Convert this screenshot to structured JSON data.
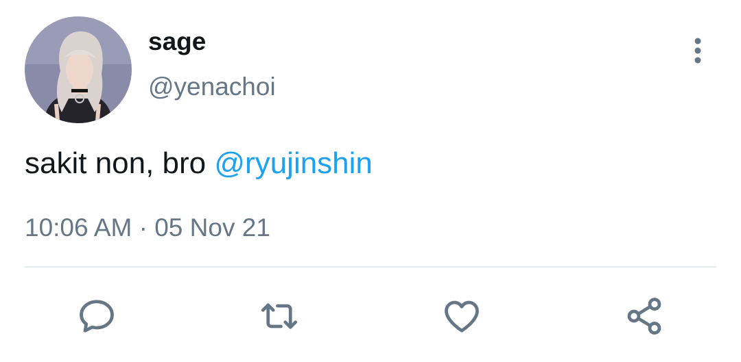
{
  "tweet": {
    "author": {
      "display_name": "sage",
      "handle": "@yenachoi",
      "avatar_icon": "profile-photo"
    },
    "text": "sakit non, bro ",
    "mention": "@ryujinshin",
    "time": "10:06 AM",
    "separator": "·",
    "date": "05 Nov 21"
  },
  "actions": [
    {
      "name": "reply",
      "icon": "reply-icon"
    },
    {
      "name": "retweet",
      "icon": "retweet-icon"
    },
    {
      "name": "like",
      "icon": "heart-icon"
    },
    {
      "name": "share",
      "icon": "share-icon"
    }
  ],
  "colors": {
    "text": "#14171a",
    "secondary": "#657786",
    "link": "#1da1f2",
    "divider": "#e6ecf0"
  }
}
